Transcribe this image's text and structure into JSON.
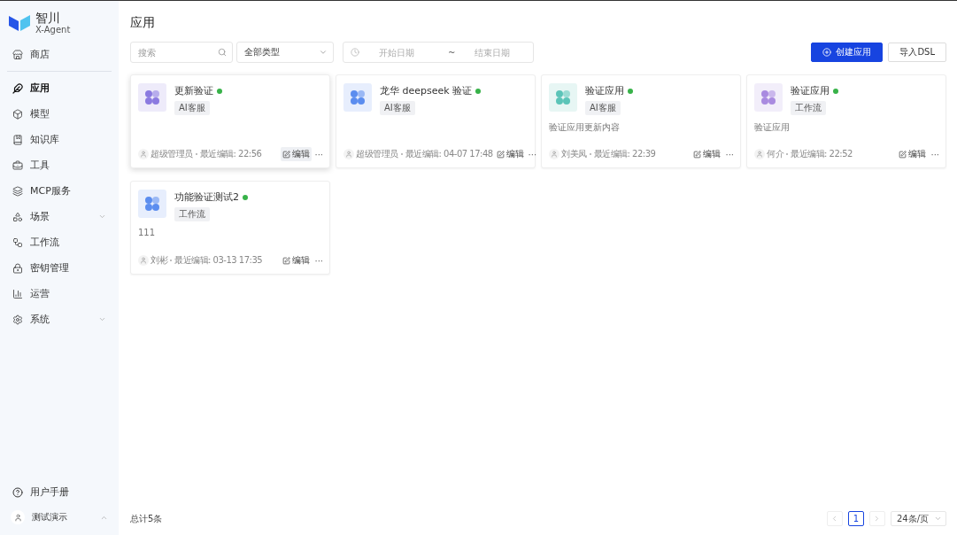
{
  "brand": {
    "name": "智川",
    "subtitle": "X-Agent"
  },
  "sidebar": {
    "top_items": [
      {
        "label": "商店",
        "selected": false
      }
    ],
    "items": [
      {
        "label": "应用",
        "selected": true,
        "expandable": false
      },
      {
        "label": "模型",
        "selected": false,
        "expandable": false
      },
      {
        "label": "知识库",
        "selected": false,
        "expandable": false
      },
      {
        "label": "工具",
        "selected": false,
        "expandable": false
      },
      {
        "label": "MCP服务",
        "selected": false,
        "expandable": false
      },
      {
        "label": "场景",
        "selected": false,
        "expandable": true
      },
      {
        "label": "工作流",
        "selected": false,
        "expandable": false
      },
      {
        "label": "密钥管理",
        "selected": false,
        "expandable": false
      },
      {
        "label": "运营",
        "selected": false,
        "expandable": false
      },
      {
        "label": "系统",
        "selected": false,
        "expandable": true
      }
    ],
    "help": "用户手册",
    "user": "测试演示"
  },
  "page": {
    "title": "应用"
  },
  "filters": {
    "search": {
      "placeholder": "搜索"
    },
    "type": {
      "value": "全部类型"
    },
    "date": {
      "start_placeholder": "开始日期",
      "separator": "~",
      "end_placeholder": "结束日期"
    }
  },
  "actions": {
    "create": "创建应用",
    "import": "导入DSL"
  },
  "cards": [
    {
      "name": "更新验证",
      "tag": "AI客服",
      "author": "超级管理员",
      "edited": "最近编辑: 22:56",
      "edit": "编辑",
      "more": "···",
      "color": "#8b7ae0",
      "hovered": true
    },
    {
      "name": "龙华 deepseek 验证",
      "tag": "AI客服",
      "author": "超级管理员",
      "edited": "最近编辑: 04-07 17:48",
      "edit": "编辑",
      "more": "···",
      "color": "#5b8def",
      "hovered": false
    },
    {
      "name": "验证应用",
      "tag": "AI客服",
      "description": "验证应用更新内容",
      "author": "刘美凤",
      "edited": "最近编辑: 22:39",
      "edit": "编辑",
      "more": "···",
      "color": "#5bc4b8",
      "hovered": false
    },
    {
      "name": "验证应用",
      "tag": "工作流",
      "description": "验证应用",
      "author": "何介",
      "edited": "最近编辑: 22:52",
      "edit": "编辑",
      "more": "···",
      "color": "#a98be0",
      "hovered": false
    },
    {
      "name": "功能验证测试2",
      "tag": "工作流",
      "description": "111",
      "author": "刘彬",
      "edited": "最近编辑: 03-13 17:35",
      "edit": "编辑",
      "more": "···",
      "color": "#5b8def",
      "hovered": false
    }
  ],
  "footer": {
    "total": "总计5条",
    "pages": [
      {
        "label": "1",
        "selected": true
      }
    ],
    "page_size": "24条/页"
  }
}
